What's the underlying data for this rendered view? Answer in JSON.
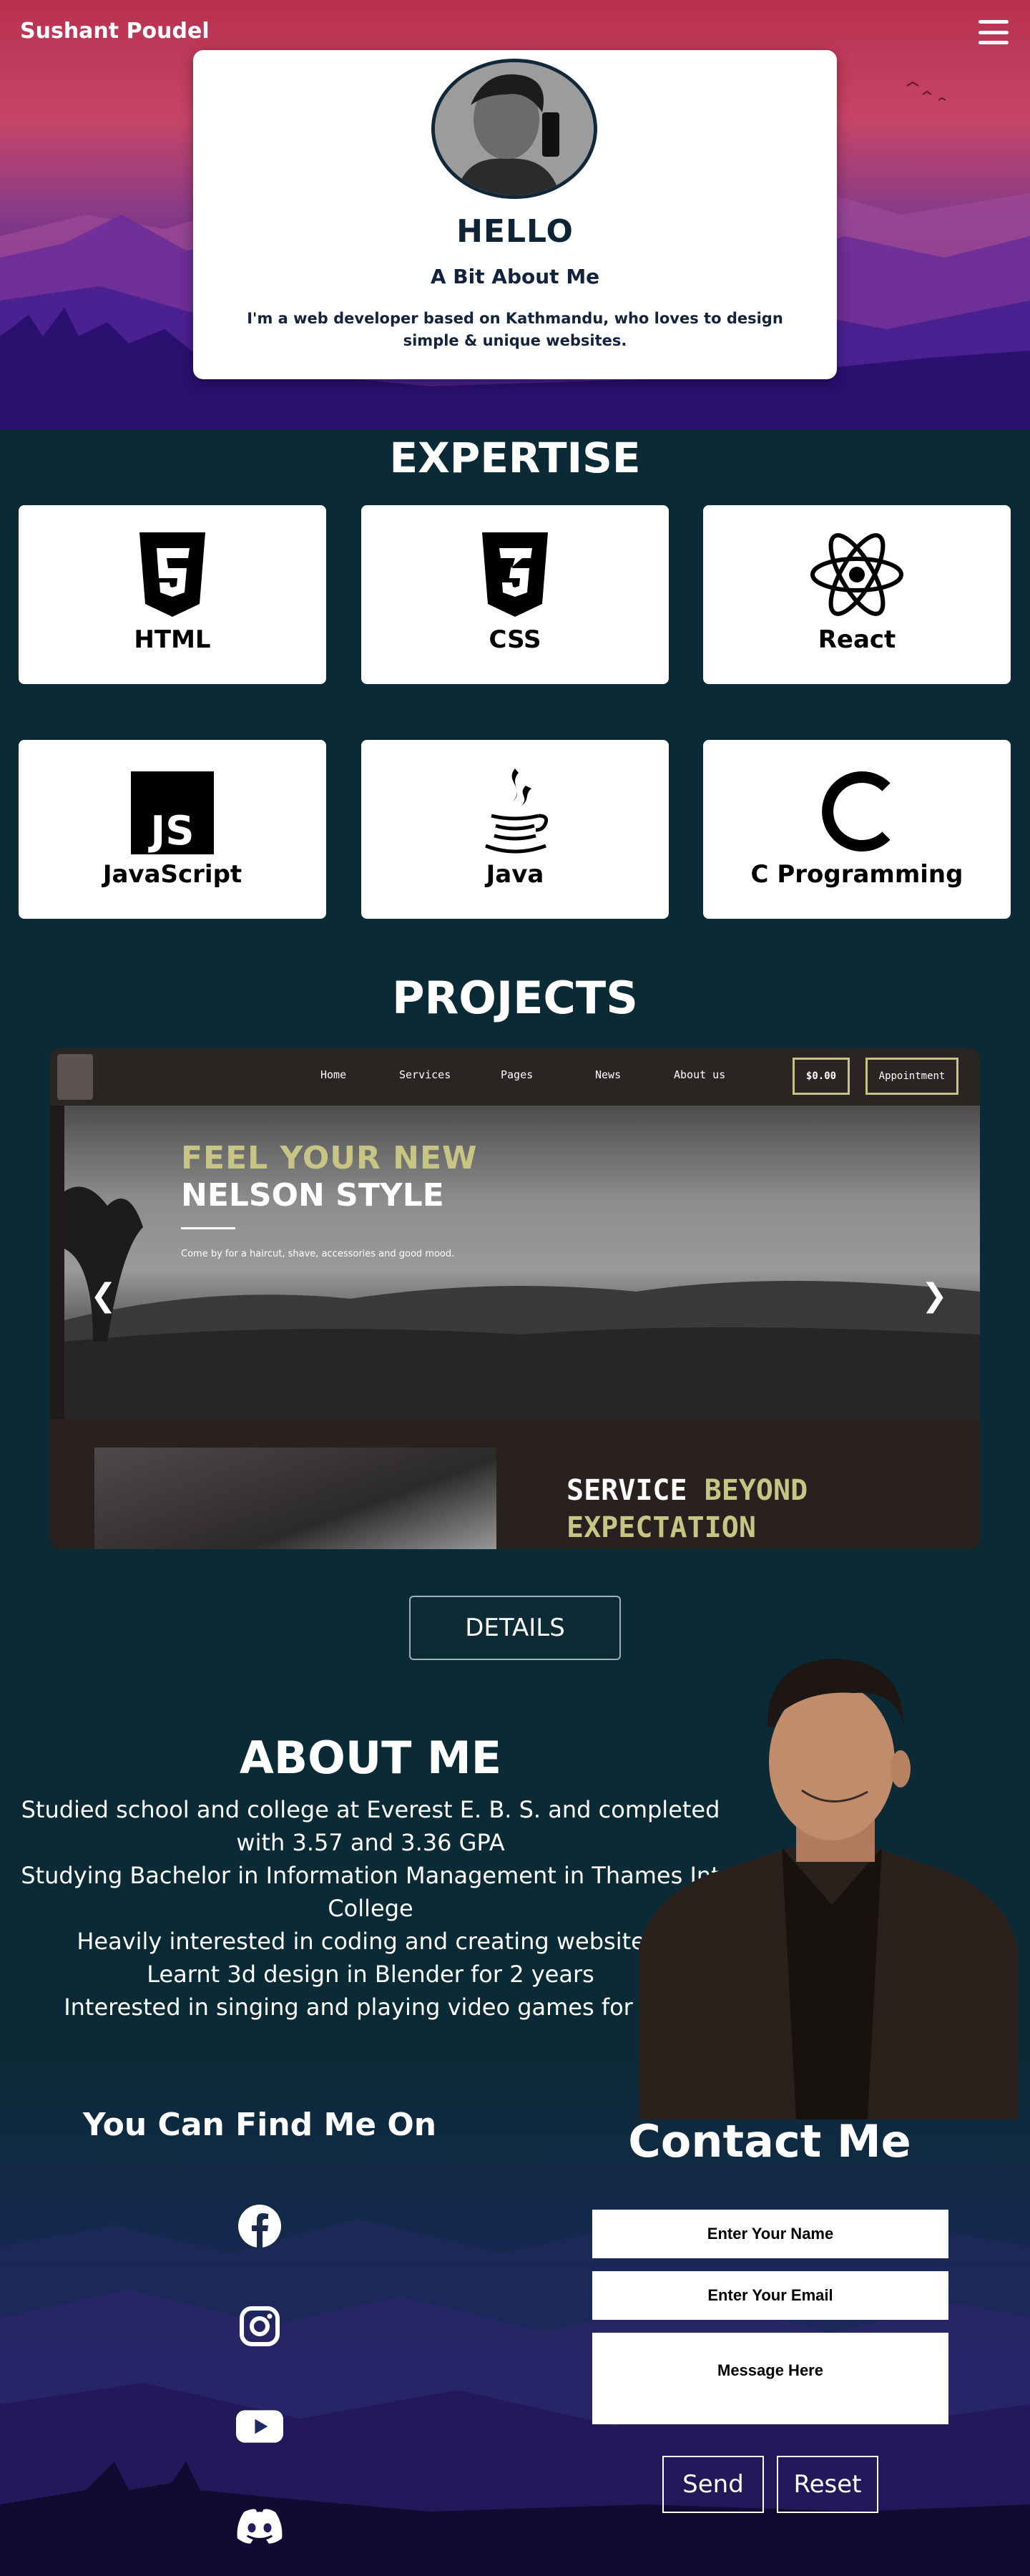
{
  "header": {
    "brand": "Sushant Poudel",
    "menu_icon": "hamburger-menu-icon"
  },
  "hello": {
    "title": "HELLO",
    "subtitle": "A Bit About Me",
    "text": "I'm a web developer based on Kathmandu, who loves to design simple & unique websites."
  },
  "expertise": {
    "title": "EXPERTISE",
    "skills": [
      {
        "label": "HTML",
        "icon": "html5-icon"
      },
      {
        "label": "CSS",
        "icon": "css3-icon"
      },
      {
        "label": "React",
        "icon": "react-icon"
      },
      {
        "label": "JavaScript",
        "icon": "javascript-icon"
      },
      {
        "label": "Java",
        "icon": "java-icon"
      },
      {
        "label": "C Programming",
        "icon": "c-icon"
      }
    ]
  },
  "projects": {
    "title": "PROJECTS",
    "slide": {
      "nav": [
        "Home",
        "Services",
        "Pages",
        "News",
        "About us"
      ],
      "cart": "$0.00",
      "appointment": "Appointment",
      "headline_1": "FEEL YOUR NEW",
      "headline_2": "NELSON STYLE",
      "description": "Come by for a haircut, shave, accessories and good mood.",
      "service_1": "SERVICE",
      "service_2": "BEYOND",
      "service_3": "EXPECTATION"
    },
    "prev": "❮",
    "next": "❯",
    "details": "DETAILS"
  },
  "about": {
    "title": "ABOUT ME",
    "lines": [
      "Studied school and college at Everest E. B. S. and completed with 3.57 and 3.36 GPA",
      "Studying Bachelor in Information Management in Thames Int College",
      "Heavily interested in coding and creating websites.",
      "Learnt 3d design in Blender for 2 years",
      "Interested in singing and playing video games for fun"
    ]
  },
  "find": {
    "title": "You Can Find Me On",
    "socials": [
      "facebook-icon",
      "instagram-icon",
      "youtube-icon",
      "discord-icon"
    ]
  },
  "contact": {
    "title": "Contact Me",
    "name_placeholder": "Enter Your Name",
    "email_placeholder": "Enter Your Email",
    "message_placeholder": "Message Here",
    "send": "Send",
    "reset": "Reset"
  }
}
